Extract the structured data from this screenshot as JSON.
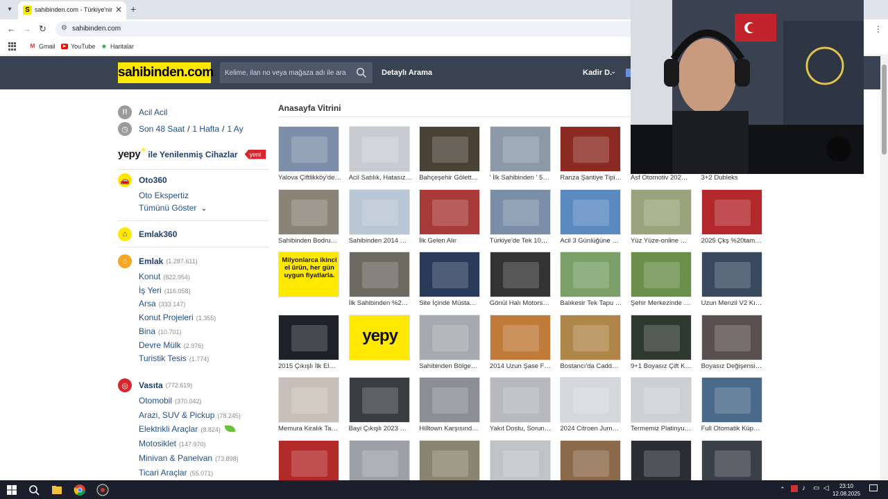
{
  "browser": {
    "tab_title": "sahibinden.com - Türkiye'nin O",
    "tab_favicon_letter": "S",
    "url": "sahibinden.com",
    "bookmarks": [
      "Gmail",
      "YouTube",
      "Haritalar"
    ]
  },
  "header": {
    "logo_text": "sahibinden.com",
    "search_placeholder": "Kelime, ilan no veya mağaza adı ile ara",
    "detailed_search": "Detaylı Arama",
    "user_name": "Kadir D."
  },
  "sidebar": {
    "acil_label": "Acil Acil",
    "recent": [
      "Son 48 Saat",
      "1 Hafta",
      "1 Ay"
    ],
    "yepy_logo": "yepy",
    "yepy_text": "ile Yenilenmiş Cihazlar",
    "yepy_badge": "yeni",
    "oto360": {
      "title": "Oto360",
      "links": [
        "Oto Ekspertiz",
        "Tümünü Göster"
      ]
    },
    "emlak360": {
      "title": "Emlak360"
    },
    "emlak": {
      "title": "Emlak",
      "count": "(1.287.611)",
      "items": [
        {
          "label": "Konut",
          "count": "(822.954)"
        },
        {
          "label": "İş Yeri",
          "count": "(116.058)"
        },
        {
          "label": "Arsa",
          "count": "(333.147)"
        },
        {
          "label": "Konut Projeleri",
          "count": "(1.355)"
        },
        {
          "label": "Bina",
          "count": "(10.701)"
        },
        {
          "label": "Devre Mülk",
          "count": "(2.976)"
        },
        {
          "label": "Turistik Tesis",
          "count": "(1.774)"
        }
      ]
    },
    "vasita": {
      "title": "Vasıta",
      "count": "(772.619)",
      "items": [
        {
          "label": "Otomobil",
          "count": "(370.042)"
        },
        {
          "label": "Arazi, SUV & Pickup",
          "count": "(78.245)"
        },
        {
          "label": "Elektrikli Araçlar",
          "count": "(8.824)"
        },
        {
          "label": "Motosiklet",
          "count": "(147.970)"
        },
        {
          "label": "Minivan & Panelvan",
          "count": "(73.898)"
        },
        {
          "label": "Ticari Araçlar",
          "count": "(55.071)"
        }
      ]
    }
  },
  "main": {
    "title": "Anasayfa Vitrini",
    "listings": [
      {
        "title": "Yalova Çiftlikköy'de…",
        "color": "#7d8fa8"
      },
      {
        "title": "Acil Satılık, Hatasız…",
        "color": "#c8ccd1"
      },
      {
        "title": "Bahçeşehir Gölett…",
        "color": "#4a4236"
      },
      {
        "title": "' İlk Sahibinden ' 5…",
        "color": "#8c9aa8"
      },
      {
        "title": "Ranza Şantiye Tipi…",
        "color": "#8a2a22"
      },
      {
        "title": "Asf Otomotiv 202…",
        "color": "#666"
      },
      {
        "title": "3+2 Dubleks",
        "color": "#999"
      },
      {
        "title": "Sahibinden Bodru…",
        "color": "#8a8478"
      },
      {
        "title": "Sahibinden 2014 …",
        "color": "#b9c6d4"
      },
      {
        "title": "İlk Gelen Alır",
        "color": "#a83a3a"
      },
      {
        "title": "Türkiye'de Tek 10…",
        "color": "#7a8ea8"
      },
      {
        "title": "Acil 3 Günlüğüne …",
        "color": "#5b8ac0"
      },
      {
        "title": "Yüz Yüze-online …",
        "color": "#9aa37c"
      },
      {
        "title": "2025 Çkş %20tam…",
        "color": "#b3282d"
      },
      {
        "title": "Milyonlarca ikinci el ürün, her gün uygun fiyatlarla.",
        "color": "#ffe800",
        "ad": "Milyonlarca ikinci el ürün, her gün uygun fiyatlarla."
      },
      {
        "title": "İlk Sahibinden %2…",
        "color": "#6d6a62"
      },
      {
        "title": "Site İçinde Müsta…",
        "color": "#2a3a5a"
      },
      {
        "title": "Gönül Halı Motors…",
        "color": "#333"
      },
      {
        "title": "Balıkesir Tek Tapu …",
        "color": "#7aa068"
      },
      {
        "title": "Şehir Merkezinde …",
        "color": "#6a8f4a"
      },
      {
        "title": "Uzun Menzil V2 Kı…",
        "color": "#3a4a5e"
      },
      {
        "title": "2015 Çıkışlı İlk El…",
        "color": "#1e2228"
      },
      {
        "title": "",
        "color": "#ffe800",
        "ad": "yepy"
      },
      {
        "title": "Sahibinden Bölge…",
        "color": "#a6a9ad"
      },
      {
        "title": "2014 Uzun Şase F…",
        "color": "#c07a3a"
      },
      {
        "title": "Bostancı'da Cadd…",
        "color": "#b0854a"
      },
      {
        "title": "9+1 Boyasız Çift K…",
        "color": "#2e3a30"
      },
      {
        "title": "Boyasız Değişensi…",
        "color": "#5a5050"
      },
      {
        "title": "Memura Kiralık Ta…",
        "color": "#c8c0b8"
      },
      {
        "title": "Bayi Çıkışlı 2023 …",
        "color": "#3a3d40"
      },
      {
        "title": "Hilltown Karşısınd…",
        "color": "#8a8f95"
      },
      {
        "title": "Yakıt Dostu, Sorun…",
        "color": "#b7b9bc"
      },
      {
        "title": "2024 Citroen Jum…",
        "color": "#d5d8db"
      },
      {
        "title": "Termemiz Platinyu…",
        "color": "#cdd0d3"
      },
      {
        "title": "Full Otomatik Küp…",
        "color": "#4a6a8a"
      },
      {
        "title": "",
        "color": "#b22a2a"
      },
      {
        "title": "",
        "color": "#9aa0a6"
      },
      {
        "title": "",
        "color": "#8a8570"
      },
      {
        "title": "",
        "color": "#c0c3c6"
      },
      {
        "title": "",
        "color": "#8a6a4a"
      },
      {
        "title": "",
        "color": "#2a2e34"
      },
      {
        "title": "",
        "color": "#3a4048"
      }
    ]
  },
  "taskbar": {
    "time": "23:10",
    "date": "12.08.2025"
  }
}
